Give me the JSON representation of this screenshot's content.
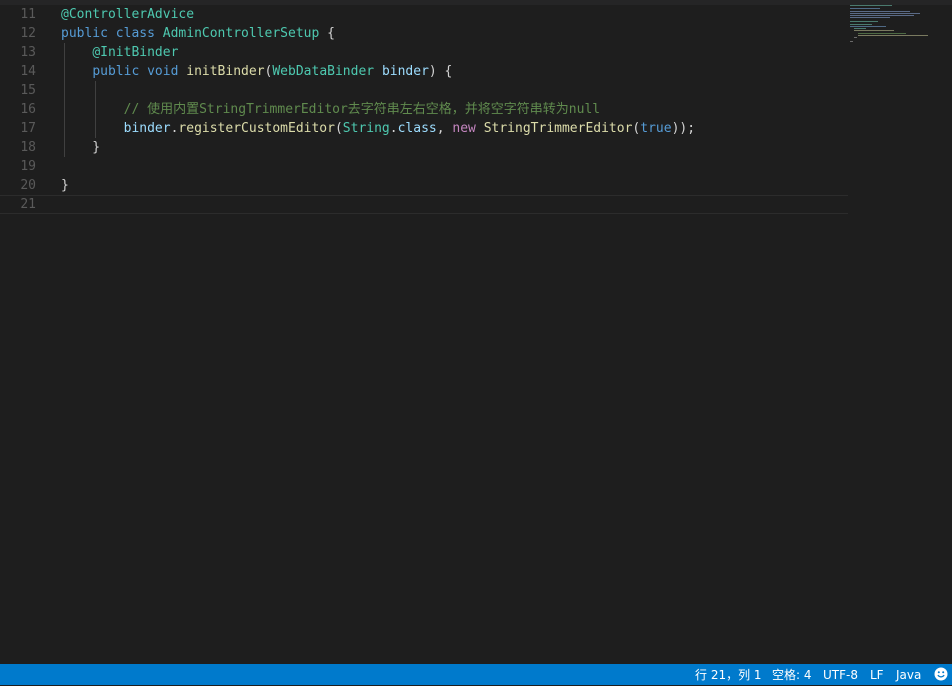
{
  "editor": {
    "lines": [
      {
        "number": "11",
        "segments": [
          {
            "t": "@ControllerAdvice",
            "c": "t-anno"
          }
        ]
      },
      {
        "number": "12",
        "segments": [
          {
            "t": "public",
            "c": "t-kw"
          },
          {
            "t": " ",
            "c": "t-default"
          },
          {
            "t": "class",
            "c": "t-kw"
          },
          {
            "t": " ",
            "c": "t-default"
          },
          {
            "t": "AdminControllerSetup",
            "c": "t-type"
          },
          {
            "t": " {",
            "c": "t-default"
          }
        ]
      },
      {
        "number": "13",
        "segments": [
          {
            "t": "    ",
            "c": "t-default"
          },
          {
            "t": "@InitBinder",
            "c": "t-anno"
          }
        ]
      },
      {
        "number": "14",
        "segments": [
          {
            "t": "    ",
            "c": "t-default"
          },
          {
            "t": "public",
            "c": "t-kw"
          },
          {
            "t": " ",
            "c": "t-default"
          },
          {
            "t": "void",
            "c": "t-kw"
          },
          {
            "t": " ",
            "c": "t-default"
          },
          {
            "t": "initBinder",
            "c": "t-func"
          },
          {
            "t": "(",
            "c": "t-default"
          },
          {
            "t": "WebDataBinder",
            "c": "t-type"
          },
          {
            "t": " ",
            "c": "t-default"
          },
          {
            "t": "binder",
            "c": "t-var"
          },
          {
            "t": ") {",
            "c": "t-default"
          }
        ]
      },
      {
        "number": "15",
        "segments": []
      },
      {
        "number": "16",
        "segments": [
          {
            "t": "        ",
            "c": "t-default"
          },
          {
            "t": "// 使用内置StringTrimmerEditor去字符串左右空格，并将空字符串转为null",
            "c": "t-comment"
          }
        ]
      },
      {
        "number": "17",
        "segments": [
          {
            "t": "        ",
            "c": "t-default"
          },
          {
            "t": "binder",
            "c": "t-var"
          },
          {
            "t": ".",
            "c": "t-default"
          },
          {
            "t": "registerCustomEditor",
            "c": "t-func"
          },
          {
            "t": "(",
            "c": "t-default"
          },
          {
            "t": "String",
            "c": "t-type"
          },
          {
            "t": ".",
            "c": "t-default"
          },
          {
            "t": "class",
            "c": "t-var"
          },
          {
            "t": ", ",
            "c": "t-default"
          },
          {
            "t": "new",
            "c": "t-new"
          },
          {
            "t": " ",
            "c": "t-default"
          },
          {
            "t": "StringTrimmerEditor",
            "c": "t-func"
          },
          {
            "t": "(",
            "c": "t-default"
          },
          {
            "t": "true",
            "c": "t-kw"
          },
          {
            "t": "));",
            "c": "t-default"
          }
        ]
      },
      {
        "number": "18",
        "segments": [
          {
            "t": "    }",
            "c": "t-default"
          }
        ]
      },
      {
        "number": "19",
        "segments": []
      },
      {
        "number": "20",
        "segments": [
          {
            "t": "}",
            "c": "t-default"
          }
        ]
      },
      {
        "number": "21",
        "segments": []
      }
    ],
    "current_line": "21"
  },
  "statusbar": {
    "position": "行 21，列 1",
    "indent": "空格: 4",
    "encoding": "UTF-8",
    "eol": "LF",
    "language": "Java",
    "feedback_icon": "smiley-icon"
  },
  "colors": {
    "background": "#1e1e1e",
    "statusbar": "#007acc",
    "line_number": "#5a5a5a",
    "keyword": "#569cd6",
    "type": "#4ec9b0",
    "function": "#dcdcaa",
    "variable": "#9cdcfe",
    "comment": "#608b4e"
  }
}
